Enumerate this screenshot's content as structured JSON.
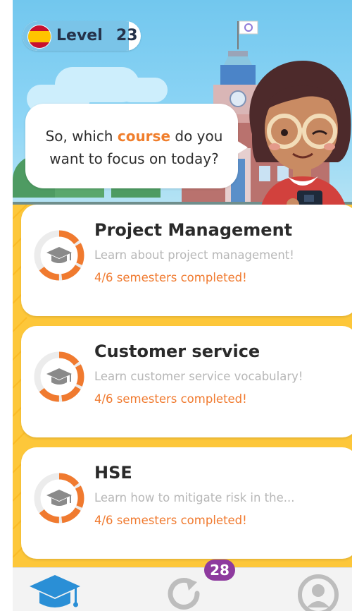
{
  "header": {
    "language_flag": "spain-flag-icon",
    "level_label": "Level",
    "level_number": "23",
    "level_progress": 0.9
  },
  "speech": {
    "part1": "So, which ",
    "highlight": "course",
    "part2": " do you want to focus on today?"
  },
  "courses": [
    {
      "title": "Project Management",
      "description": "Learn about project management!",
      "progress_text": "4/6 semesters completed!",
      "progress": 0.667
    },
    {
      "title": "Customer service",
      "description": "Learn customer service vocabulary!",
      "progress_text": "4/6 semesters completed!",
      "progress": 0.667
    },
    {
      "title": "HSE",
      "description": "Learn how to mitigate risk in the...",
      "progress_text": "4/6 semesters completed!",
      "progress": 0.667
    }
  ],
  "nav": {
    "learn_icon": "graduation-cap-icon",
    "review_icon": "refresh-icon",
    "review_badge": "28",
    "profile_icon": "profile-icon"
  },
  "colors": {
    "accent_orange": "#f07a2f",
    "list_background": "#fdc73a",
    "badge": "#8e3a9e",
    "nav_active": "#2a8fd6"
  }
}
